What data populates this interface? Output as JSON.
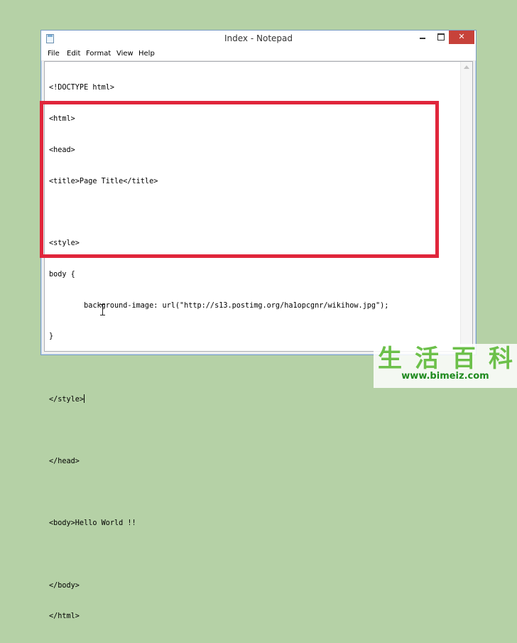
{
  "window": {
    "title": "Index - Notepad",
    "close_glyph": "✕"
  },
  "menu": {
    "items": [
      "File",
      "Edit",
      "Format",
      "View",
      "Help"
    ]
  },
  "editor": {
    "lines": [
      "<!DOCTYPE html>",
      "<html>",
      "<head>",
      "<title>Page Title</title>",
      "",
      "<style>",
      "body {",
      "        background-image: url(\"http://s13.postimg.org/ha1opcgnr/wikihow.jpg\");",
      "}",
      "",
      "</style>",
      "",
      "</head>",
      "",
      "<body>Hello World !!",
      "",
      "</body>",
      "</html>"
    ],
    "caret_line": 10
  },
  "watermark": {
    "chars": [
      "生",
      "活",
      "百",
      "科"
    ],
    "url": "www.bimeiz.com"
  },
  "colors": {
    "highlight": "#e0263b",
    "background": "#b5d1a6",
    "close_button": "#c7423a",
    "watermark": "#6cc04a"
  }
}
